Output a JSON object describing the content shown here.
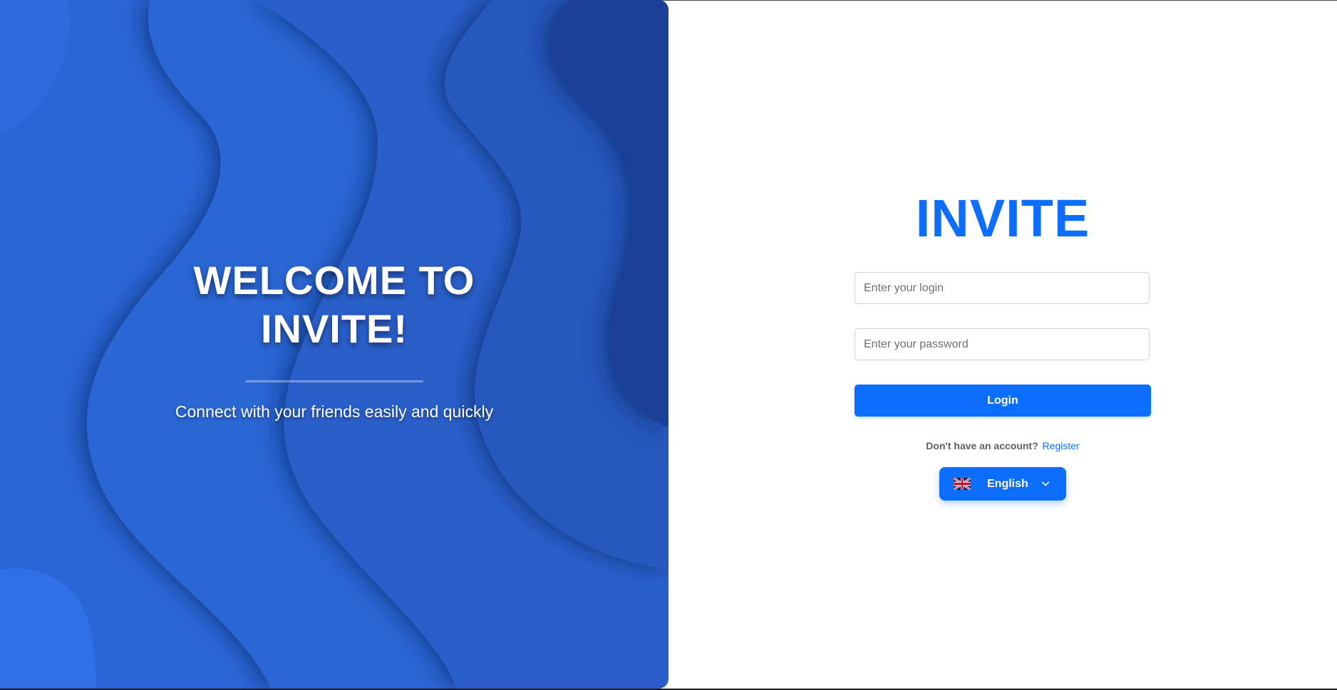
{
  "hero": {
    "title": "WELCOME TO INVITE!",
    "subtitle": "Connect with your friends easily and quickly"
  },
  "login": {
    "brand": "INVITE",
    "login_field": {
      "placeholder": "Enter your login",
      "value": ""
    },
    "password_field": {
      "placeholder": "Enter your password",
      "value": ""
    },
    "login_button": "Login",
    "register_prompt": "Don't have an account?",
    "register_link": "Register",
    "language": {
      "selected": "English",
      "flag_icon": "uk-flag-icon",
      "chevron_icon": "chevron-down-icon"
    }
  },
  "colors": {
    "accent": "#0d6efd",
    "hero_background": "#2a62cc"
  }
}
